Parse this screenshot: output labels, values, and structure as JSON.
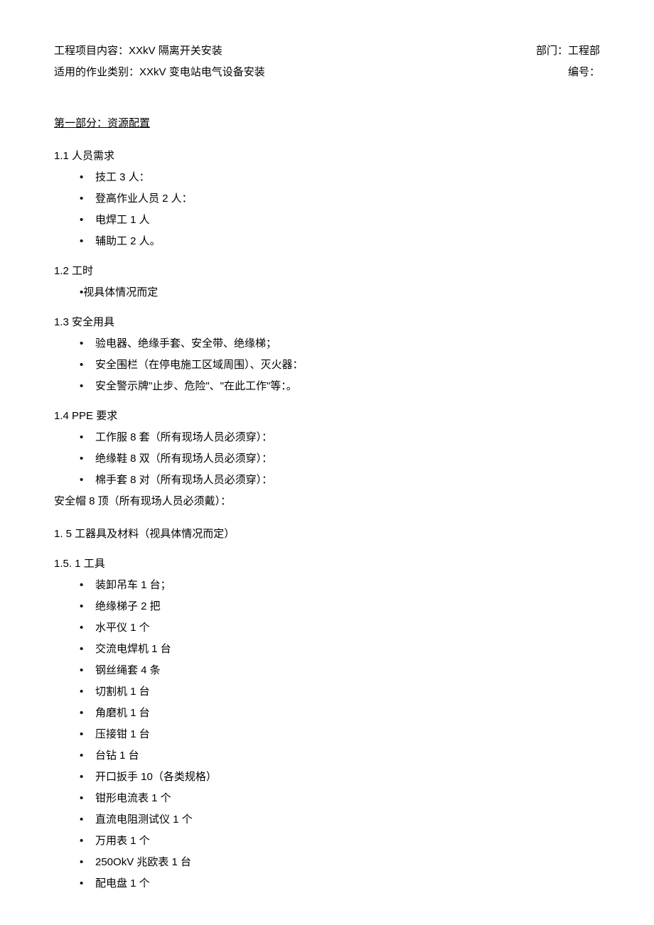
{
  "header": {
    "project_content_label": "工程项目内容：",
    "project_content_value": "XXkV 隔离开关安装",
    "work_type_label": "适用的作业类别：",
    "work_type_value": "XXkV 变电站电气设备安装",
    "department_label": "部门：",
    "department_value": "工程部",
    "number_label": "编号："
  },
  "section1": {
    "title": "第一部分：资源配置",
    "s1_1": {
      "label": "1.1   人员需求",
      "items": [
        "技工 3 人：",
        "登高作业人员 2 人：",
        "电焊工 1 人",
        "辅助工 2 人。"
      ]
    },
    "s1_2": {
      "label": "1.2   工时",
      "note": "•视具体情况而定"
    },
    "s1_3": {
      "label": "1.3   安全用具",
      "items": [
        "验电器、绝缘手套、安全带、绝缘梯；",
        "安全围栏（在停电施工区域周围）、灭火器：",
        "安全警示牌\"止步、危险\"、\"在此工作\"等：。"
      ]
    },
    "s1_4": {
      "label": "1.4   PPE 要求",
      "items": [
        "工作服 8 套（所有现场人员必须穿）：",
        "绝缘鞋 8 双（所有现场人员必须穿）：",
        "棉手套 8 对（所有现场人员必须穿）："
      ],
      "trailing": "安全帽 8 顶（所有现场人员必须戴）："
    },
    "s1_5": {
      "label": "1. 5 工器具及材料（视具体情况而定）"
    },
    "s1_5_1": {
      "label": "1.5.   1 工具",
      "items": [
        "装卸吊车 1 台；",
        "绝缘梯子 2 把",
        "水平仪 1 个",
        "交流电焊机 1 台",
        "钢丝绳套 4 条",
        "切割机 1 台",
        "角磨机 1 台",
        "压接钳 1 台",
        "台钻 1 台",
        "开口扳手 10（各类规格）",
        "钳形电流表 1 个",
        "直流电阻测试仪 1 个",
        "万用表 1 个",
        "250OkV 兆欧表 1 台",
        "配电盘 1 个"
      ]
    }
  }
}
